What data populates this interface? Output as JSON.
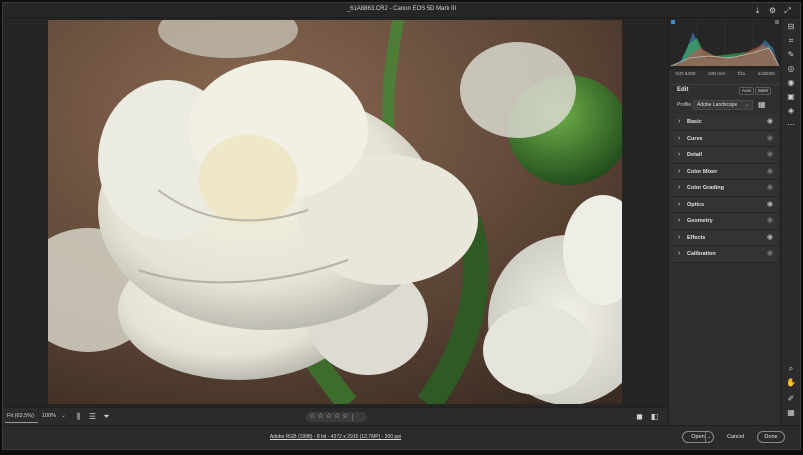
{
  "titlebar": {
    "title": "_61A8863.CR2  -  Canon EOS 5D Mark III",
    "icons": [
      "save-icon",
      "gear-icon",
      "expand-icon"
    ]
  },
  "histogram": {
    "colors": [
      "#3c8fd0",
      "#3fbf5a",
      "#d04a4a",
      "#bdbdbd"
    ]
  },
  "camera_info": {
    "iso": "ISO 6400",
    "focal": "100 mm",
    "aperture": "f/11",
    "shutter": "1/1600s"
  },
  "edit": {
    "title": "Edit",
    "auto_label": "Auto",
    "bw_label": "B&W",
    "profile_label": "Profile",
    "profile_value": "Adobe Landscape"
  },
  "sections": [
    {
      "label": "Basic",
      "eye": "on"
    },
    {
      "label": "Curve",
      "eye": "dim"
    },
    {
      "label": "Detail",
      "eye": "dim"
    },
    {
      "label": "Color Mixer",
      "eye": "dim"
    },
    {
      "label": "Color Grading",
      "eye": "dim"
    },
    {
      "label": "Optics",
      "eye": "on"
    },
    {
      "label": "Geometry",
      "eye": "dim"
    },
    {
      "label": "Effects",
      "eye": "on"
    },
    {
      "label": "Calibration",
      "eye": "dim"
    }
  ],
  "bottombar": {
    "zoom_fit": "Fit (63.5%)",
    "zoom_pct": "100%",
    "stars": [
      "☆",
      "☆",
      "☆",
      "☆",
      "☆"
    ]
  },
  "footer": {
    "info": "Adobe RGB (1998) - 8 bit - 4372 x 2915 (12.7MP) - 300 ppi",
    "open_label": "Open",
    "cancel_label": "Cancel",
    "done_label": "Done"
  },
  "tools": [
    "edit-icon",
    "crop-icon",
    "heal-icon",
    "mask-icon",
    "redeye-icon",
    "presets-icon",
    "snapshots-icon",
    "more-icon",
    "zoom-icon",
    "hand-icon",
    "sampler-icon",
    "grid-icon"
  ]
}
